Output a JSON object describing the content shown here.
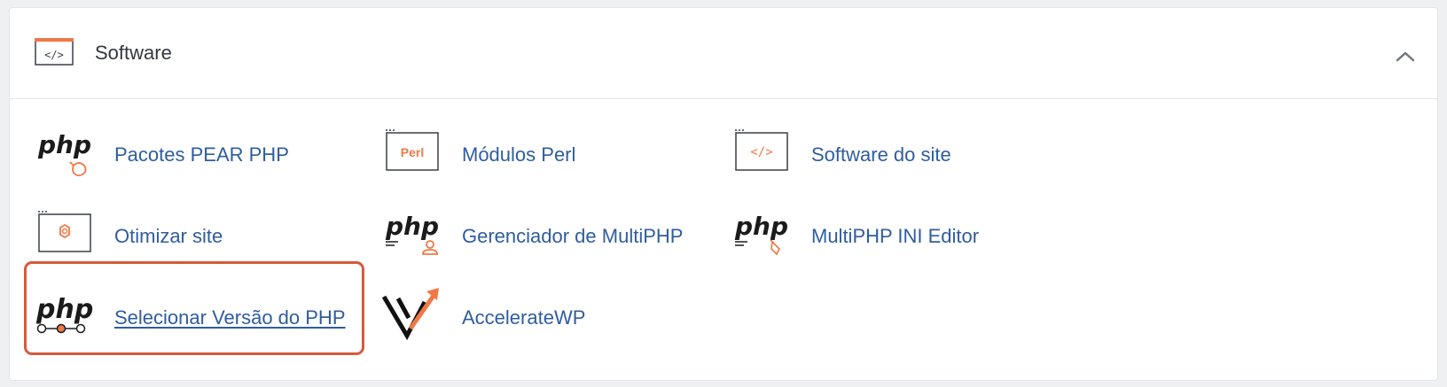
{
  "panel": {
    "title": "Software",
    "icon": "code-window-icon",
    "collapse_icon": "chevron-up-icon"
  },
  "colors": {
    "accent": "#f07845",
    "link": "#2f5d9f",
    "highlight": "#d65a3b"
  },
  "icon_text": {
    "php": "php",
    "perl": "Perl",
    "code": "</>"
  },
  "items": [
    {
      "label": "Pacotes PEAR PHP",
      "icon": "php-pear-icon"
    },
    {
      "label": "Módulos Perl",
      "icon": "perl-modules-icon"
    },
    {
      "label": "Software do site",
      "icon": "site-software-icon"
    },
    {
      "label": "Otimizar site",
      "icon": "optimize-website-icon"
    },
    {
      "label": "Gerenciador de MultiPHP",
      "icon": "multiphp-manager-icon"
    },
    {
      "label": "MultiPHP INI Editor",
      "icon": "multiphp-ini-editor-icon"
    },
    {
      "label": "Selecionar Versão do PHP",
      "icon": "php-version-selector-icon",
      "selected": true
    },
    {
      "label": "AccelerateWP",
      "icon": "acceleratewp-logo-icon"
    }
  ]
}
